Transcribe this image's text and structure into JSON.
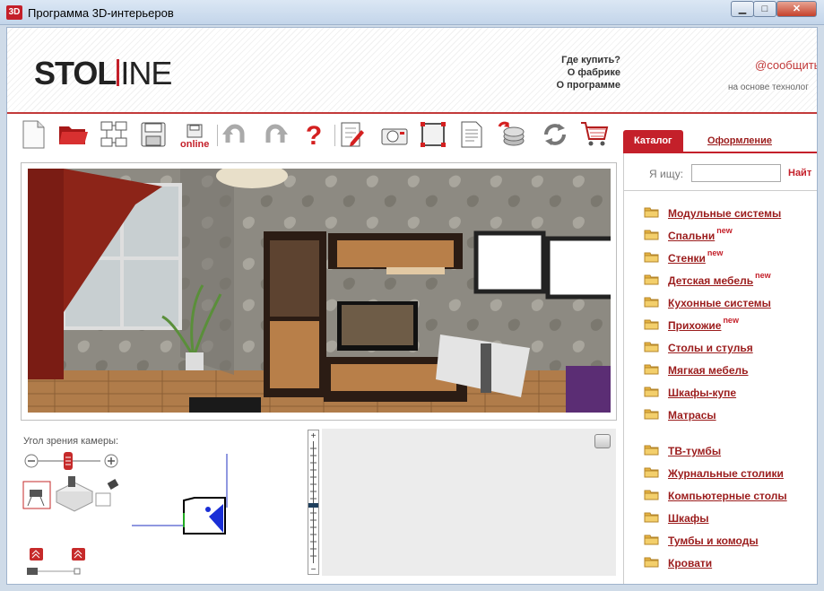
{
  "window": {
    "icon_label": "3D",
    "title": "Программа 3D-интерьеров"
  },
  "header": {
    "logo_main": "STOL",
    "logo_thin": "INE",
    "links": [
      "Где купить?",
      "О фабрике",
      "О программе"
    ],
    "contact": "@сообщить",
    "tech_note": "на основе технолог"
  },
  "toolbar": {
    "buttons": [
      "new-file-icon",
      "open-folder-icon",
      "network-icon",
      "save-icon",
      "online-icon",
      "undo-icon",
      "redo-icon",
      "help-icon",
      "edit-icon",
      "camera-icon",
      "frame-icon",
      "document-icon",
      "coins-icon",
      "refresh-icon",
      "cart-icon"
    ],
    "online_label": "online"
  },
  "camera": {
    "label": "Угол зрения камеры:",
    "zoom_minus": "−",
    "zoom_plus": "+"
  },
  "catalog": {
    "tabs": [
      "Каталог",
      "Оформление"
    ],
    "search_label": "Я ищу:",
    "search_value": "",
    "find_label": "Найт",
    "new_tag": "new",
    "items": [
      {
        "label": "Модульные системы",
        "new": false
      },
      {
        "label": "Спальни",
        "new": true
      },
      {
        "label": "Стенки",
        "new": true
      },
      {
        "label": "Детская мебель",
        "new": true
      },
      {
        "label": "Кухонные системы",
        "new": false
      },
      {
        "label": "Прихожие",
        "new": true
      },
      {
        "label": "Столы и стулья",
        "new": false
      },
      {
        "label": "Мягкая мебель",
        "new": false
      },
      {
        "label": "Шкафы-купе",
        "new": false
      },
      {
        "label": "Матрасы",
        "new": false
      },
      {
        "label": "ТВ-тумбы",
        "new": false
      },
      {
        "label": "Журнальные столики",
        "new": false
      },
      {
        "label": "Компьютерные столы",
        "new": false
      },
      {
        "label": "Шкафы",
        "new": false
      },
      {
        "label": "Тумбы и комоды",
        "new": false
      },
      {
        "label": "Кровати",
        "new": false
      }
    ]
  }
}
